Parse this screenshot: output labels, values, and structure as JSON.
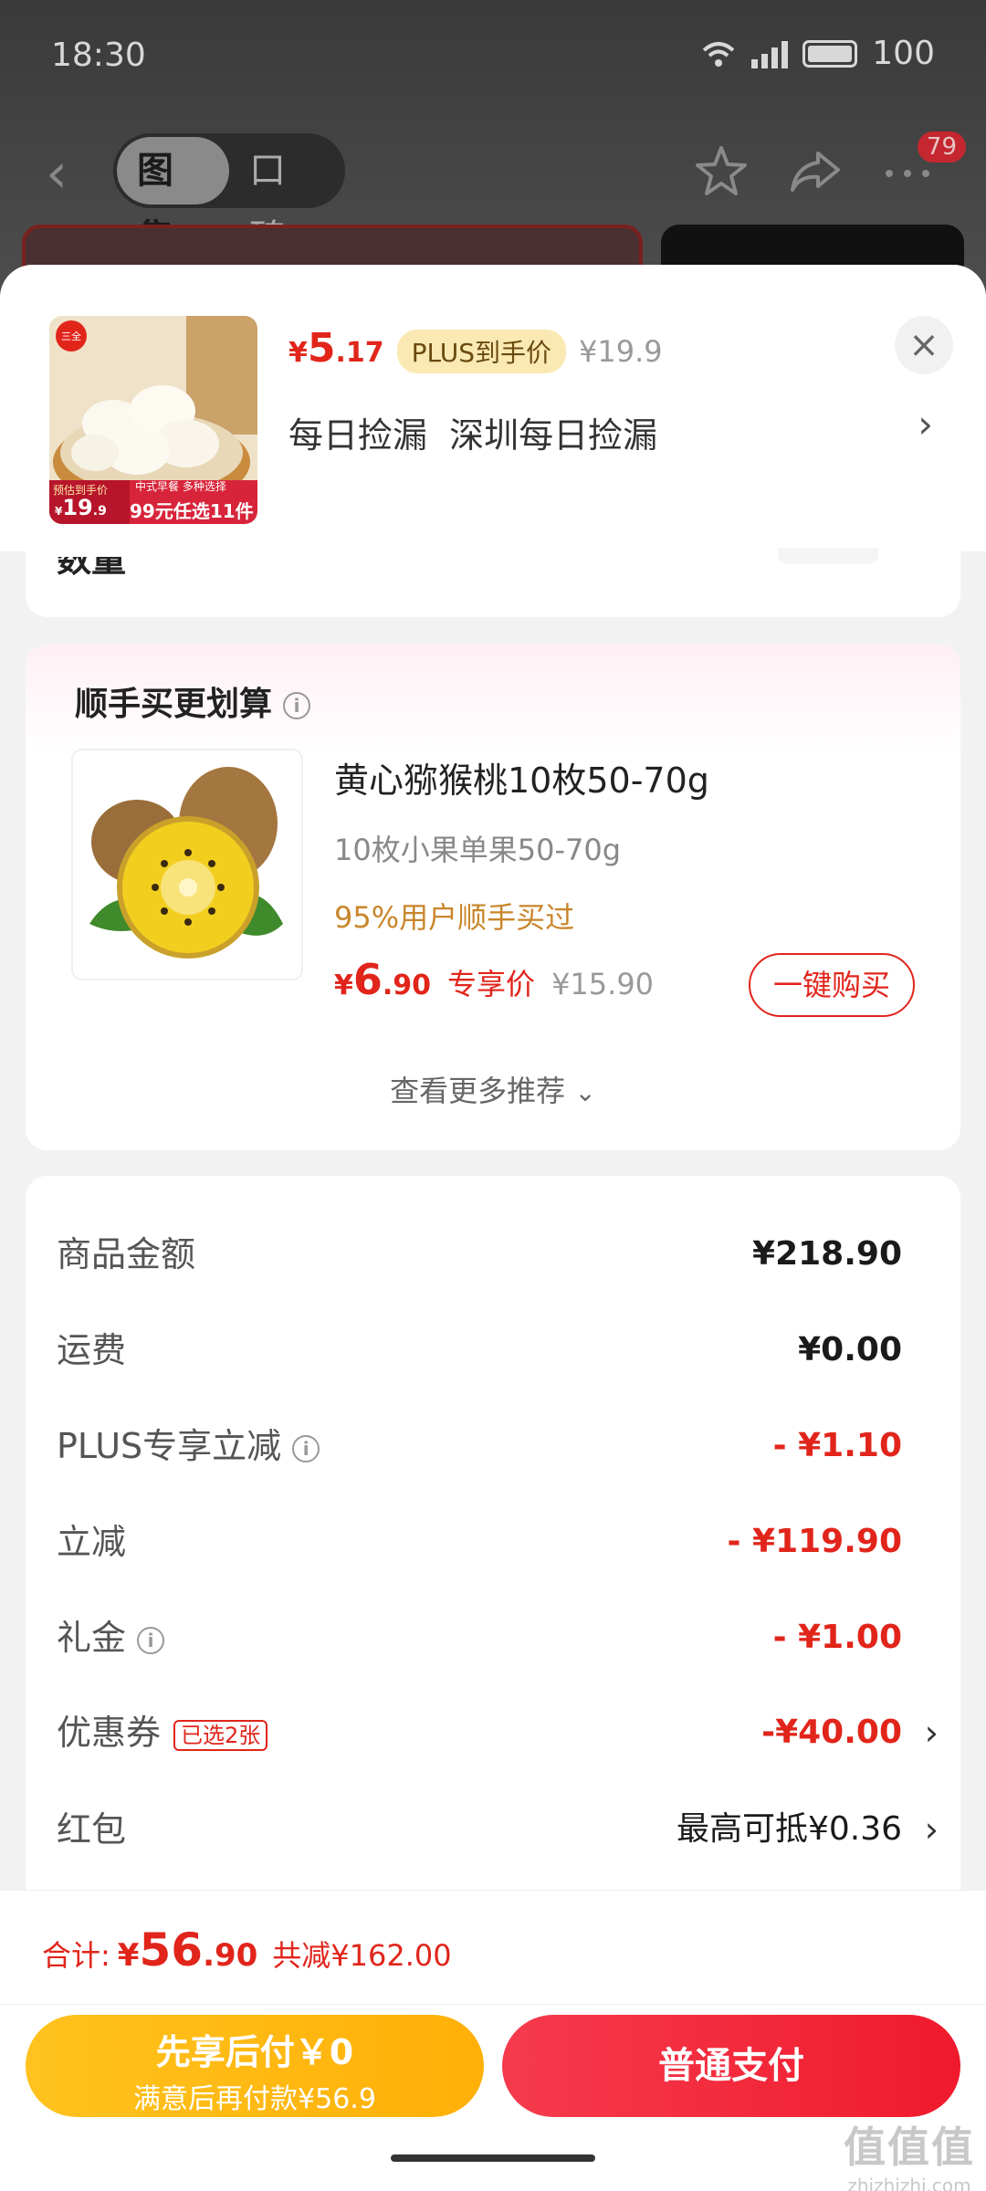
{
  "status_bar": {
    "time": "18:30",
    "network": "5G",
    "battery": "100"
  },
  "nav": {
    "tabs": [
      "图集",
      "口碑"
    ],
    "active_tab": "图集",
    "more_badge": "79"
  },
  "sheet": {
    "product": {
      "thumb_brand": "三全",
      "thumb_promo_top": "预估到手价",
      "thumb_promo_price_int": "19",
      "thumb_promo_price_dec": ".9",
      "thumb_tag_line1": "中式早餐 多种选择",
      "thumb_tag_line2": "99元任选11件",
      "price_yen": "¥",
      "price_int": "5",
      "price_dec": ".17",
      "plus_tag": "PLUS到手价",
      "original_price": "¥19.9",
      "shop_name": "每日捡漏  深圳每日捡漏"
    },
    "quantity_label_partial": "数量",
    "recommend": {
      "title": "顺手买更划算",
      "item": {
        "name": "黄心猕猴桃10枚50-70g",
        "spec": "10枚小果单果50-70g",
        "bought": "95%用户顺手买过",
        "price_yen": "¥",
        "price_int": "6",
        "price_dec": ".90",
        "exclusive": "专享价",
        "original_price": "¥15.90",
        "buy_label": "一键购买"
      },
      "more_label": "查看更多推荐"
    },
    "summary": [
      {
        "label": "商品金额",
        "value": "¥218.90",
        "red": false
      },
      {
        "label": "运费",
        "value": "¥0.00",
        "red": false
      },
      {
        "label": "PLUS专享立减",
        "value": "- ¥1.10",
        "red": true
      },
      {
        "label": "立减",
        "value": "- ¥119.90",
        "red": true
      },
      {
        "label": "礼金",
        "value": "- ¥1.00",
        "red": true
      },
      {
        "label": "优惠券",
        "tag": "已选2张",
        "value": "-¥40.00",
        "red": true
      },
      {
        "label": "红包",
        "value": "最高可抵¥0.36",
        "red": false
      }
    ]
  },
  "bottom": {
    "total_label": "合计:",
    "total_yen": "¥",
    "total_int": "56",
    "total_dec": ".90",
    "total_reduce": "共减¥162.00",
    "pay_later_main": "先享后付￥0",
    "pay_later_sub": "满意后再付款¥56.9",
    "pay_normal": "普通支付"
  },
  "watermark": {
    "mark": "值值值",
    "url": "zhizhizhi.com"
  },
  "colors": {
    "accent_red": "#e1251b",
    "pay_later_yellow": "#ffb008",
    "bought_gold": "#c9862b"
  }
}
